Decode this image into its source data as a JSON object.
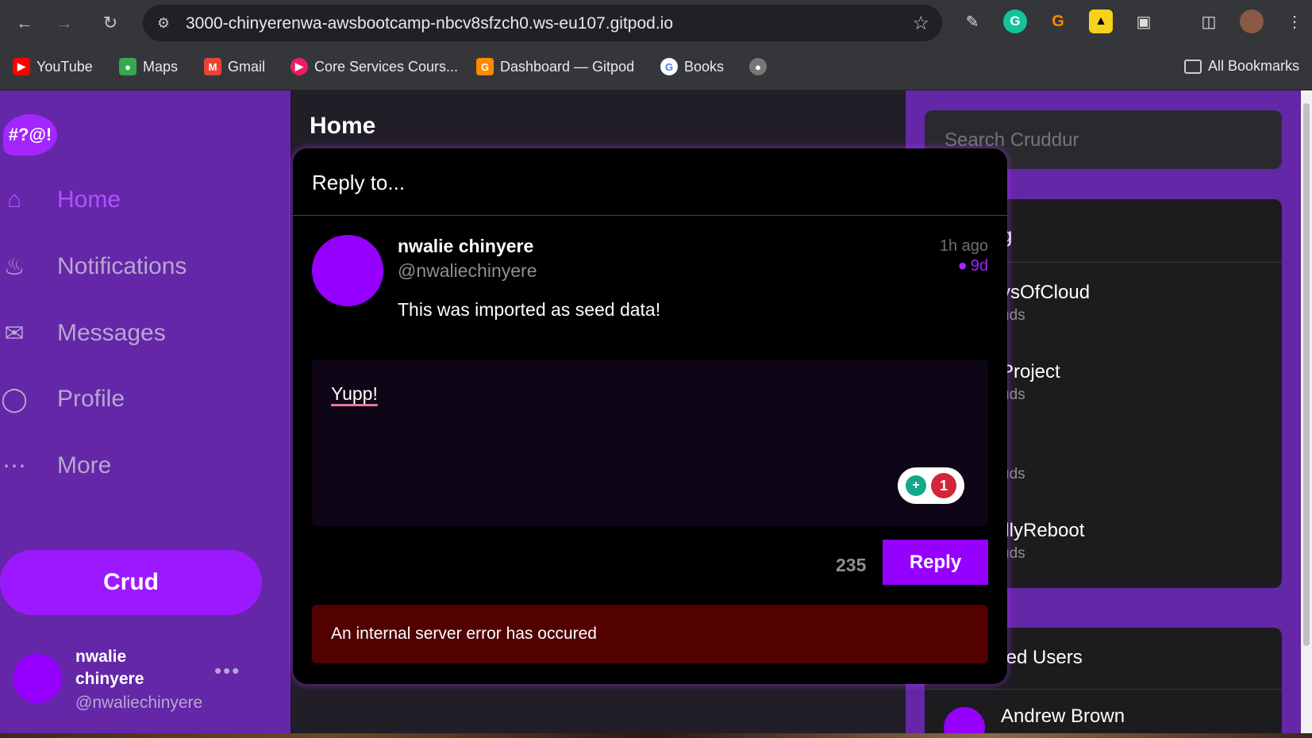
{
  "browser": {
    "url": "3000-chinyerenwa-awsbootcamp-nbcv8sfzch0.ws-eu107.gitpod.io",
    "bookmarks": [
      {
        "label": "YouTube",
        "icon": "youtube-icon",
        "color": "#ff0000"
      },
      {
        "label": "Maps",
        "icon": "maps-icon",
        "color": "#34a853"
      },
      {
        "label": "Gmail",
        "icon": "gmail-icon",
        "color": "#ea4335"
      },
      {
        "label": "Core Services Cours...",
        "icon": "course-icon",
        "color": "#e91e63"
      },
      {
        "label": "Dashboard — Gitpod",
        "icon": "gitpod-icon",
        "color": "#ff8a00"
      },
      {
        "label": "Books",
        "icon": "google-icon",
        "color": "#4285f4"
      }
    ],
    "all_bookmarks": "All Bookmarks"
  },
  "sidebar": {
    "logo": "#?@!",
    "items": [
      {
        "label": "Home",
        "icon": "home-icon"
      },
      {
        "label": "Notifications",
        "icon": "bell-icon"
      },
      {
        "label": "Messages",
        "icon": "mail-icon"
      },
      {
        "label": "Profile",
        "icon": "user-icon"
      },
      {
        "label": "More",
        "icon": "more-icon"
      }
    ],
    "crud_button": "Crud",
    "user": {
      "name": "nwalie chinyere",
      "handle": "@nwaliechinyere"
    },
    "more_dots": "•••"
  },
  "feed": {
    "title": "Home"
  },
  "modal": {
    "title": "Reply to...",
    "post": {
      "display_name": "nwalie chinyere",
      "handle": "@nwaliechinyere",
      "message": "This was imported as seed data!",
      "ago": "1h ago",
      "expires": "9d"
    },
    "reply_text": "Yupp!",
    "grammarly_count": "1",
    "char_count": "235",
    "reply_button": "Reply",
    "error": "An internal server error has occured"
  },
  "right": {
    "search_placeholder": "Search Cruddur",
    "trending_title": "g",
    "trends": [
      {
        "name": "ysOfCloud",
        "count": "uds"
      },
      {
        "name": "Project",
        "count": "uds"
      },
      {
        "name": "",
        "count": "uds"
      },
      {
        "name": "illyReboot",
        "count": "uds"
      }
    ],
    "suggested_title": "ted Users",
    "suggested_user": "Andrew Brown"
  }
}
